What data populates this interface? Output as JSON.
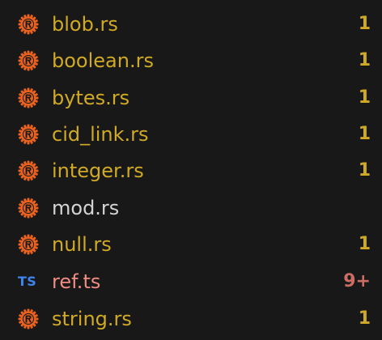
{
  "colors": {
    "background": "#181818",
    "modified": "#d0aa24",
    "normal": "#d4d4d4",
    "error": "#f08c82",
    "error_badge": "#cb6d62",
    "rust_icon": "#e8611f",
    "ts_icon": "#3d86ef"
  },
  "files": [
    {
      "name": "blob.rs",
      "icon": "rust-icon",
      "badge": "1",
      "state": "modified"
    },
    {
      "name": "boolean.rs",
      "icon": "rust-icon",
      "badge": "1",
      "state": "modified"
    },
    {
      "name": "bytes.rs",
      "icon": "rust-icon",
      "badge": "1",
      "state": "modified"
    },
    {
      "name": "cid_link.rs",
      "icon": "rust-icon",
      "badge": "1",
      "state": "modified"
    },
    {
      "name": "integer.rs",
      "icon": "rust-icon",
      "badge": "1",
      "state": "modified"
    },
    {
      "name": "mod.rs",
      "icon": "rust-icon",
      "badge": "",
      "state": "normal"
    },
    {
      "name": "null.rs",
      "icon": "rust-icon",
      "badge": "1",
      "state": "modified"
    },
    {
      "name": "ref.ts",
      "icon": "typescript-icon",
      "icon_text": "TS",
      "badge": "9+",
      "state": "error"
    },
    {
      "name": "string.rs",
      "icon": "rust-icon",
      "badge": "1",
      "state": "modified"
    }
  ]
}
